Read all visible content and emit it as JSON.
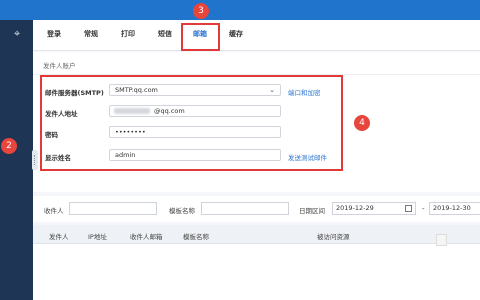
{
  "tabs": [
    "登录",
    "常规",
    "打印",
    "短信",
    "邮箱",
    "缓存"
  ],
  "section_title": "发件人账户",
  "form": {
    "smtp_label": "邮件服务器(SMTP)",
    "smtp_value": "SMTP.qq.com",
    "port_link": "端口和加密",
    "sender_label": "发件人地址",
    "sender_value_suffix": "@qq.com",
    "password_label": "密码",
    "password_value": "••••••••",
    "display_label": "显示姓名",
    "display_value": "admin",
    "test_link": "发送测试邮件"
  },
  "filters": {
    "sender_label": "收件人",
    "template_label": "模板名称",
    "date_label": "日期区间",
    "date_from": "2019-12-29",
    "date_sep": "-",
    "date_to": "2019-12-30"
  },
  "table_headers": [
    "发件人",
    "IP地址",
    "收件人邮箱",
    "模板名称",
    "被访问资源"
  ],
  "badges": [
    "3",
    "4",
    "2"
  ],
  "colors": {
    "accent": "#2174cc",
    "sidebar": "#1f3556",
    "annotation": "#e23a3a",
    "link": "#2b74cf"
  },
  "icons": {
    "pin": "pin-icon",
    "dropdown": "chevron-down-icon",
    "calendar": "calendar-icon"
  }
}
